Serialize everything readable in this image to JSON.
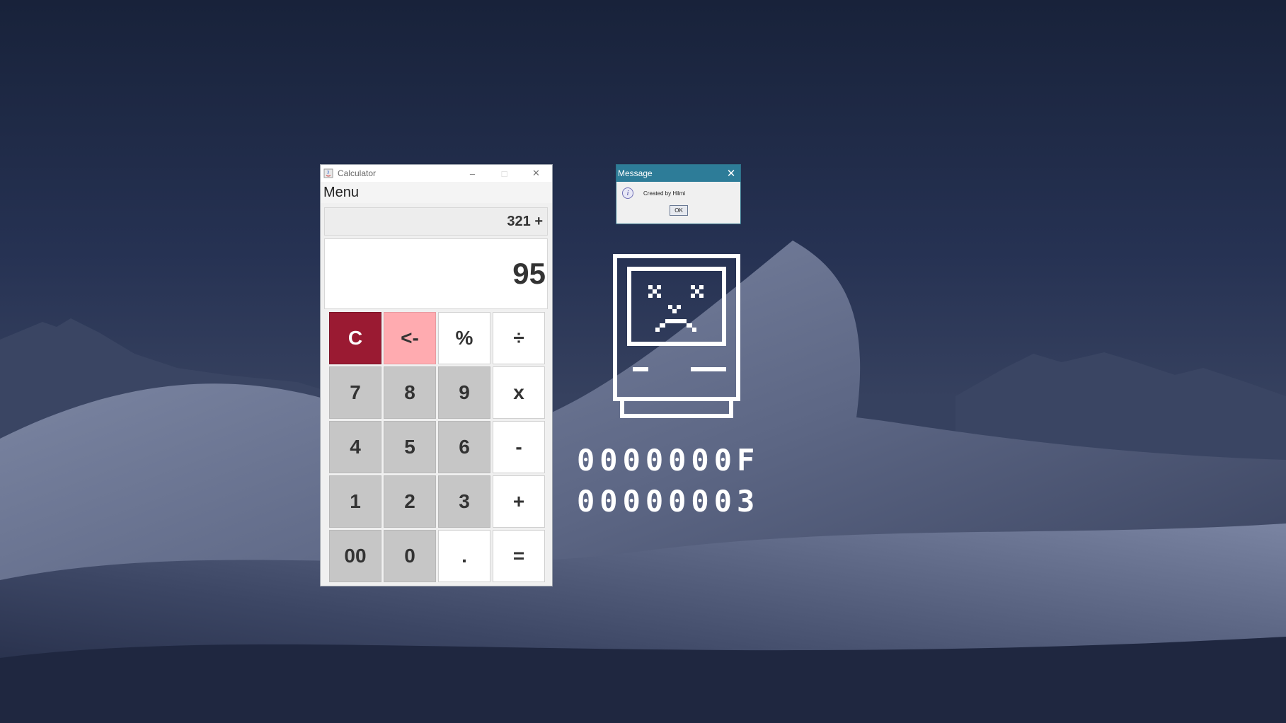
{
  "calculator": {
    "title": "Calculator",
    "controls": {
      "minimize": "–",
      "maximize": "□",
      "close": "✕"
    },
    "menu": "Menu",
    "history": "321 +",
    "display": "95",
    "keys": [
      {
        "label": "C",
        "type": "clear"
      },
      {
        "label": "<-",
        "type": "back"
      },
      {
        "label": "%",
        "type": "op"
      },
      {
        "label": "÷",
        "type": "op"
      },
      {
        "label": "7",
        "type": "num"
      },
      {
        "label": "8",
        "type": "num"
      },
      {
        "label": "9",
        "type": "num"
      },
      {
        "label": "x",
        "type": "op"
      },
      {
        "label": "4",
        "type": "num"
      },
      {
        "label": "5",
        "type": "num"
      },
      {
        "label": "6",
        "type": "num"
      },
      {
        "label": "-",
        "type": "op"
      },
      {
        "label": "1",
        "type": "num"
      },
      {
        "label": "2",
        "type": "num"
      },
      {
        "label": "3",
        "type": "num"
      },
      {
        "label": "+",
        "type": "op"
      },
      {
        "label": "00",
        "type": "num"
      },
      {
        "label": "0",
        "type": "num"
      },
      {
        "label": ".",
        "type": "op"
      },
      {
        "label": "=",
        "type": "op"
      }
    ]
  },
  "message_dialog": {
    "title": "Message",
    "close": "✕",
    "text": "Created by Hilmi",
    "ok_label": "OK",
    "icon": "info-icon"
  },
  "sad_mac": {
    "icon": "sad-mac-icon",
    "codes": [
      "0000000F",
      "00000003"
    ]
  },
  "colors": {
    "clear_key": "#9a1a32",
    "back_key": "#ffabb0",
    "dialog_titlebar": "#2d7c98"
  }
}
